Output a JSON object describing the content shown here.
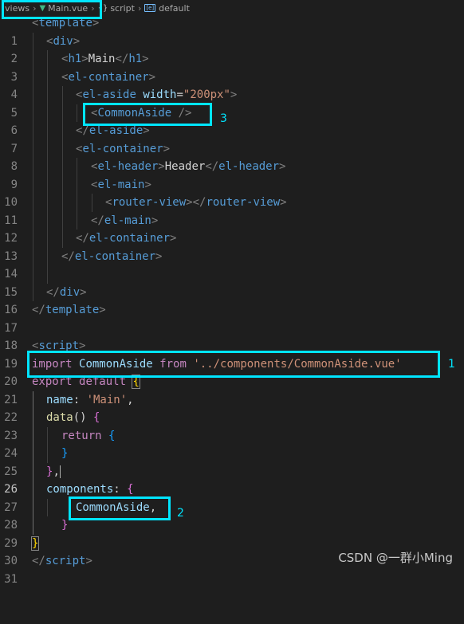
{
  "breadcrumb": {
    "folder": "views",
    "file": "Main.vue",
    "section": "script",
    "symbol": "default"
  },
  "annotations": {
    "one": "1",
    "two": "2",
    "three": "3"
  },
  "watermark": "CSDN @一群小Ming",
  "current_line": "26",
  "line_numbers": [
    "1",
    "2",
    "3",
    "4",
    "5",
    "6",
    "7",
    "8",
    "9",
    "10",
    "11",
    "12",
    "13",
    "14",
    "15",
    "16",
    "17",
    "18",
    "19",
    "20",
    "21",
    "22",
    "23",
    "24",
    "25",
    "26",
    "27",
    "28",
    "29",
    "30",
    "31"
  ],
  "code": {
    "l1": [
      "<",
      "template",
      ">"
    ],
    "l2": [
      "<",
      "div",
      ">"
    ],
    "l3": [
      "<",
      "h1",
      ">",
      "Main",
      "</",
      "h1",
      ">"
    ],
    "l4": [
      "<",
      "el-container",
      ">"
    ],
    "l5": [
      "<",
      "el-aside",
      " ",
      "width",
      "=",
      "\"200px\"",
      ">"
    ],
    "l6": [
      "<",
      "CommonAside",
      " />"
    ],
    "l7": [
      "</",
      "el-aside",
      ">"
    ],
    "l8": [
      "<",
      "el-container",
      ">"
    ],
    "l9": [
      "<",
      "el-header",
      ">",
      "Header",
      "</",
      "el-header",
      ">"
    ],
    "l10": [
      "<",
      "el-main",
      ">"
    ],
    "l11": [
      "<",
      "router-view",
      ">",
      "</",
      "router-view",
      ">"
    ],
    "l12": [
      "</",
      "el-main",
      ">"
    ],
    "l13": [
      "</",
      "el-container",
      ">"
    ],
    "l14": [
      "</",
      "el-container",
      ">"
    ],
    "l16": [
      "</",
      "div",
      ">"
    ],
    "l17": [
      "</",
      "template",
      ">"
    ],
    "l19": [
      "<",
      "script",
      ">"
    ],
    "l20": [
      "import",
      " ",
      "CommonAside",
      " ",
      "from",
      " ",
      "'../components/CommonAside.vue'"
    ],
    "l21": [
      "export",
      " ",
      "default",
      " ",
      "{"
    ],
    "l22": [
      "name",
      ": ",
      "'Main'",
      ","
    ],
    "l23": [
      "data",
      "() ",
      "{"
    ],
    "l24": [
      "return",
      " ",
      "{"
    ],
    "l25": [
      "}"
    ],
    "l26": [
      "}",
      ","
    ],
    "l27": [
      "components",
      ": ",
      "{"
    ],
    "l28": [
      "CommonAside",
      ","
    ],
    "l29": [
      "}"
    ],
    "l30": [
      "}"
    ],
    "l31": [
      "</",
      "script",
      ">"
    ]
  }
}
